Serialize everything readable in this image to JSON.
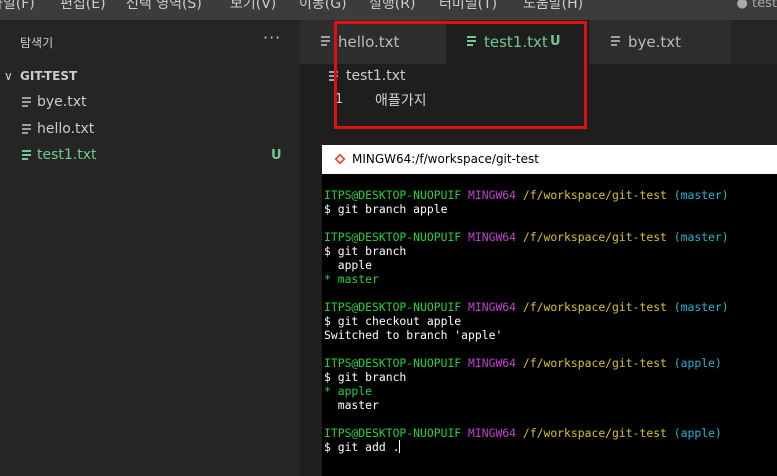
{
  "menubar": {
    "items": [
      "파일(F)",
      "편집(E)",
      "선택 영역(S)",
      "보기(V)",
      "이동(G)",
      "실행(R)",
      "터미널(T)",
      "도움말(H)"
    ],
    "window_title": "● test"
  },
  "sidebar": {
    "title": "탐색기",
    "more_label": "···",
    "folder": {
      "chevron": "∨",
      "name": "GIT-TEST"
    },
    "files": [
      {
        "name": "bye.txt",
        "status": ""
      },
      {
        "name": "hello.txt",
        "status": ""
      },
      {
        "name": "test1.txt",
        "status": "U"
      }
    ]
  },
  "tabs": [
    {
      "label": "hello.txt",
      "status": ""
    },
    {
      "label": "test1.txt",
      "status": "U",
      "active": true,
      "dirty": true
    },
    {
      "label": "bye.txt",
      "status": ""
    }
  ],
  "editor": {
    "breadcrumb": "test1.txt",
    "lines": [
      {
        "number": "1",
        "text": "애플가지"
      }
    ]
  },
  "terminal": {
    "title": "MINGW64:/f/workspace/git-test",
    "prompt": {
      "user": "ITPS@DESKTOP-NUOPUIF",
      "system": "MINGW64",
      "path": "/f/workspace/git-test"
    },
    "lines": [
      {
        "type": "prompt",
        "branch": "(master)"
      },
      {
        "type": "cmd",
        "text": "$ git branch apple"
      },
      {
        "type": "blank"
      },
      {
        "type": "prompt",
        "branch": "(master)"
      },
      {
        "type": "cmd",
        "text": "$ git branch"
      },
      {
        "type": "out",
        "text": "  apple"
      },
      {
        "type": "cur",
        "text": "* master"
      },
      {
        "type": "blank"
      },
      {
        "type": "prompt",
        "branch": "(master)"
      },
      {
        "type": "cmd",
        "text": "$ git checkout apple"
      },
      {
        "type": "out",
        "text": "Switched to branch 'apple'"
      },
      {
        "type": "blank"
      },
      {
        "type": "prompt",
        "branch": "(apple)"
      },
      {
        "type": "cmd",
        "text": "$ git branch"
      },
      {
        "type": "cur",
        "text": "* apple"
      },
      {
        "type": "out",
        "text": "  master"
      },
      {
        "type": "blank"
      },
      {
        "type": "prompt",
        "branch": "(apple)"
      },
      {
        "type": "cmd",
        "text": "$ git add .",
        "cursor": true
      }
    ]
  },
  "colors": {
    "modified_green": "#73c991",
    "highlight_red": "#e01010",
    "term_user": "#23d13c",
    "term_mingw": "#c23fd0",
    "term_path": "#d7c42a",
    "term_branch": "#20b6cf"
  }
}
